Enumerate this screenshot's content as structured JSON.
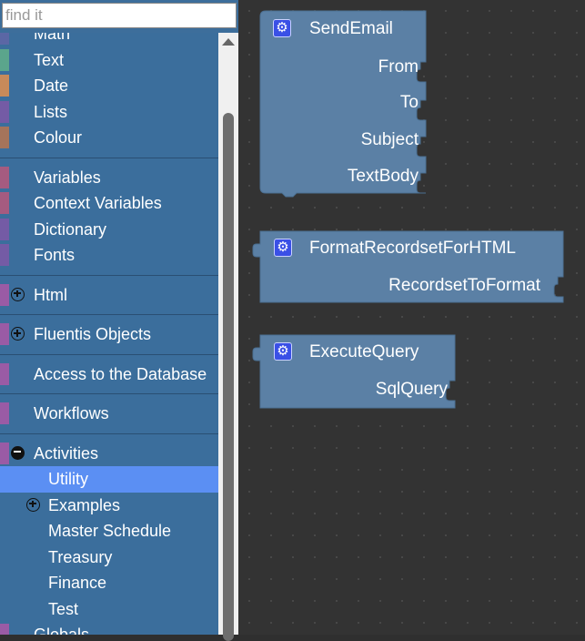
{
  "search": {
    "placeholder": "find it"
  },
  "toolbox": {
    "partial_top_item": "Math",
    "group1": [
      {
        "label": "Text",
        "color": "#5ba58c"
      },
      {
        "label": "Date",
        "color": "#c88a5a"
      },
      {
        "label": "Lists",
        "color": "#745ba5"
      },
      {
        "label": "Colour",
        "color": "#a5745b"
      }
    ],
    "group2": [
      {
        "label": "Variables",
        "color": "#a55b80"
      },
      {
        "label": "Context Variables",
        "color": "#a55b80"
      },
      {
        "label": "Dictionary",
        "color": "#745ba5"
      },
      {
        "label": "Fonts",
        "color": "#745ba5"
      }
    ],
    "html": {
      "label": "Html",
      "color": "#9a5ba5"
    },
    "fluentis": {
      "label": "Fluentis Objects",
      "color": "#9a5ba5"
    },
    "database": {
      "label": "Access to the Database",
      "color": "#9a5ba5"
    },
    "workflows": {
      "label": "Workflows",
      "color": "#9a5ba5"
    },
    "activities": {
      "label": "Activities",
      "color": "#9a5ba5",
      "children": [
        "Utility",
        "Examples",
        "Master Schedule",
        "Treasury",
        "Finance",
        "Test"
      ]
    },
    "partial_bottom_item": "Globals"
  },
  "blocks": {
    "send_email": {
      "title": "SendEmail",
      "inputs": [
        "From",
        "To",
        "Subject",
        "TextBody"
      ]
    },
    "format_recordset": {
      "title": "FormatRecordsetForHTML",
      "inputs": [
        "RecordsetToFormat"
      ]
    },
    "execute_query": {
      "title": "ExecuteQuery",
      "inputs": [
        "SqlQuery"
      ]
    },
    "block_color": "#5b80a5",
    "gear_icon": "gear-icon"
  }
}
